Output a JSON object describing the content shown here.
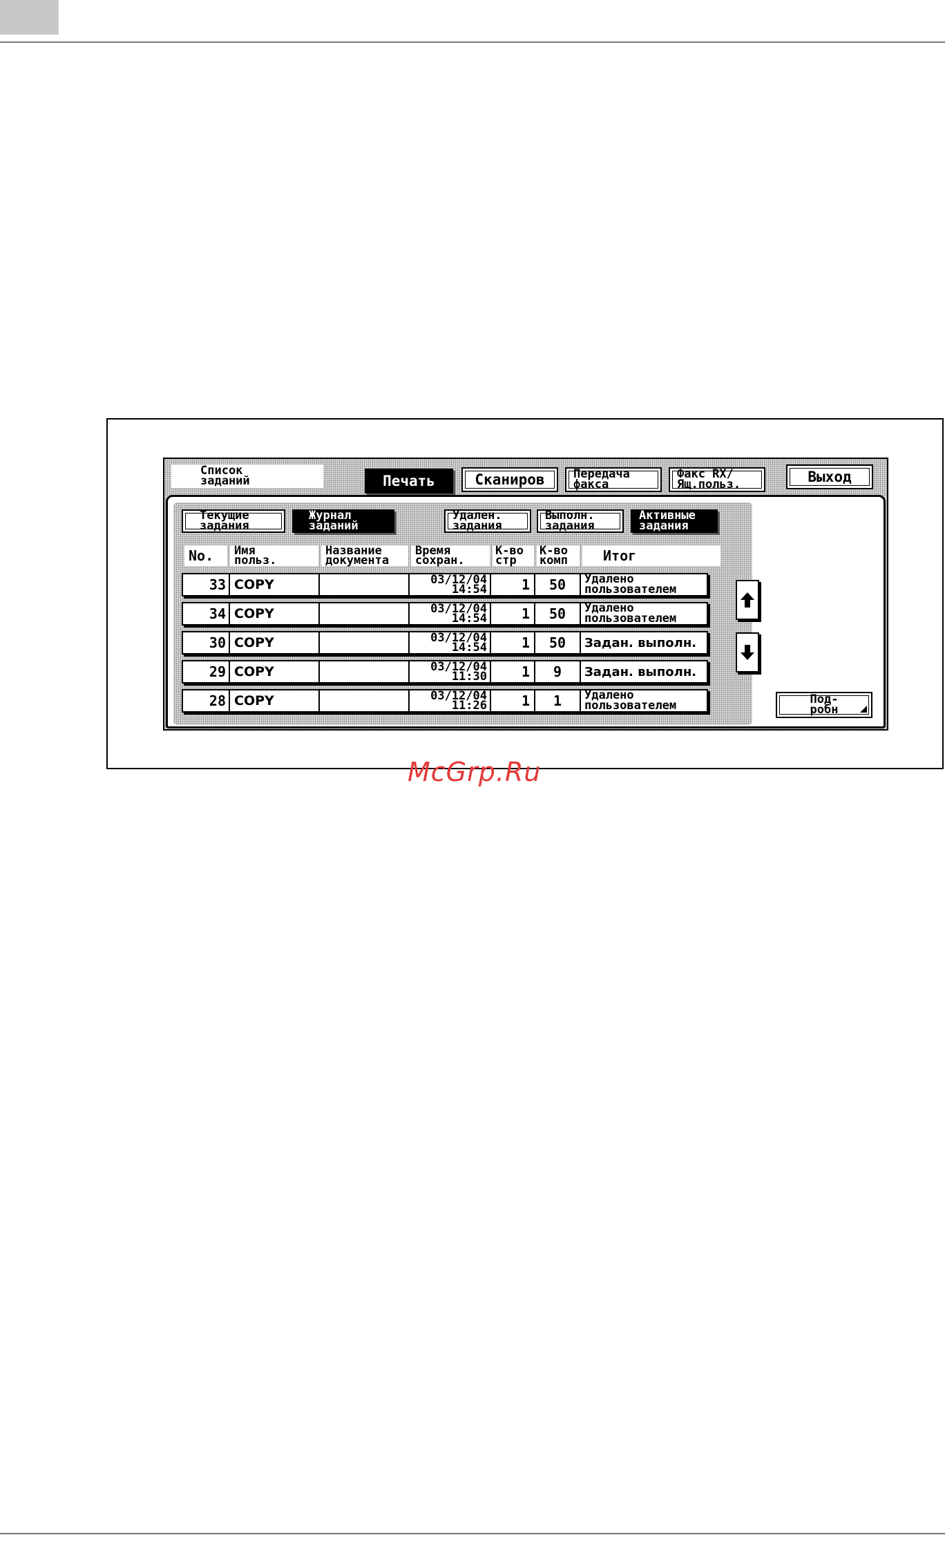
{
  "screen": {
    "title_line1": "Список",
    "title_line2": "заданий",
    "tabs": [
      {
        "label_line1": "Печать",
        "label_line2": "",
        "active": true
      },
      {
        "label_line1": "Сканиров",
        "label_line2": "",
        "active": false
      },
      {
        "label_line1": "Передача",
        "label_line2": "факса",
        "active": false
      },
      {
        "label_line1": "Факс RX/",
        "label_line2": "Ящ.польз.",
        "active": false
      }
    ],
    "exit_label": "Выход",
    "subtabs": [
      {
        "label_line1": "Текущие",
        "label_line2": "задания",
        "active": false
      },
      {
        "label_line1": "Журнал",
        "label_line2": "заданий",
        "active": true
      }
    ],
    "filters": [
      {
        "label_line1": "Удален.",
        "label_line2": "задания",
        "active": false
      },
      {
        "label_line1": "Выполн.",
        "label_line2": "задания",
        "active": false
      },
      {
        "label_line1": "Активные",
        "label_line2": "задания",
        "active": true
      }
    ],
    "columns": [
      {
        "line1": "No.",
        "line2": ""
      },
      {
        "line1": "Имя",
        "line2": "польз."
      },
      {
        "line1": "Название",
        "line2": "документа"
      },
      {
        "line1": "Время",
        "line2": "сохран."
      },
      {
        "line1": "К-во",
        "line2": "стр"
      },
      {
        "line1": "К-во",
        "line2": "комп"
      },
      {
        "line1": "Итог",
        "line2": ""
      }
    ],
    "rows": [
      {
        "no": "33",
        "user": "COPY",
        "doc": "",
        "date": "03/12/04",
        "time": "14:54",
        "pages": "1",
        "copies": "50",
        "result_line1": "Удалено",
        "result_line2": "пользователем"
      },
      {
        "no": "34",
        "user": "COPY",
        "doc": "",
        "date": "03/12/04",
        "time": "14:54",
        "pages": "1",
        "copies": "50",
        "result_line1": "Удалено",
        "result_line2": "пользователем"
      },
      {
        "no": "30",
        "user": "COPY",
        "doc": "",
        "date": "03/12/04",
        "time": "14:54",
        "pages": "1",
        "copies": "50",
        "result_line1": "Задан. выполн.",
        "result_line2": ""
      },
      {
        "no": "29",
        "user": "COPY",
        "doc": "",
        "date": "03/12/04",
        "time": "11:30",
        "pages": "1",
        "copies": "9",
        "result_line1": "Задан. выполн.",
        "result_line2": ""
      },
      {
        "no": "28",
        "user": "COPY",
        "doc": "",
        "date": "03/12/04",
        "time": "11:26",
        "pages": "1",
        "copies": "1",
        "result_line1": "Удалено",
        "result_line2": "пользователем"
      }
    ],
    "details_line1": "Под-",
    "details_line2": "робн"
  },
  "watermark": "McGrp.Ru"
}
